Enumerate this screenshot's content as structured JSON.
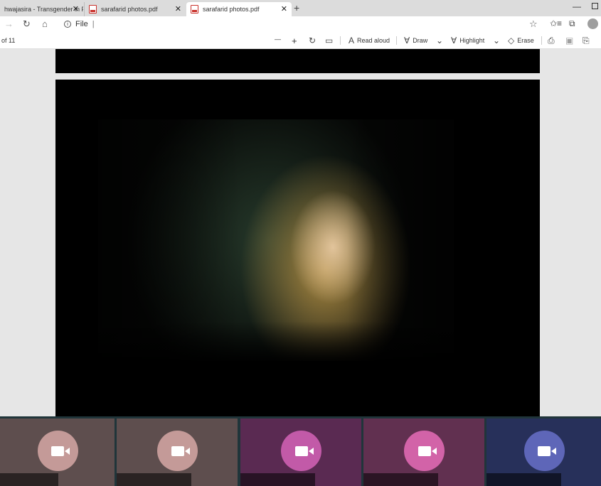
{
  "tabs": [
    {
      "label": "hwajasira - Transgender in Paki",
      "close": "✕"
    },
    {
      "label": "sarafarid photos.pdf",
      "close": "✕"
    },
    {
      "label": "sarafarid photos.pdf",
      "close": "✕"
    }
  ],
  "new_tab": "+",
  "window": {
    "minimize": "—"
  },
  "address": {
    "scheme_label": "File",
    "url": "|"
  },
  "pdf_toolbar": {
    "page_count": "of 11",
    "zoom_out": "—",
    "zoom_in": "+",
    "read_aloud": "Read aloud",
    "draw": "Draw",
    "highlight": "Highlight",
    "erase": "Erase"
  },
  "meeting": {
    "tiles": [
      {
        "bg": "#5e4e4e",
        "cam": "#c49a98"
      },
      {
        "bg": "#5e4e4e",
        "cam": "#c49a98"
      },
      {
        "bg": "#5a2a52",
        "cam": "#c25aa8"
      },
      {
        "bg": "#613050",
        "cam": "#d263a8"
      },
      {
        "bg": "#27305a",
        "cam": "#5e66b8"
      }
    ]
  }
}
